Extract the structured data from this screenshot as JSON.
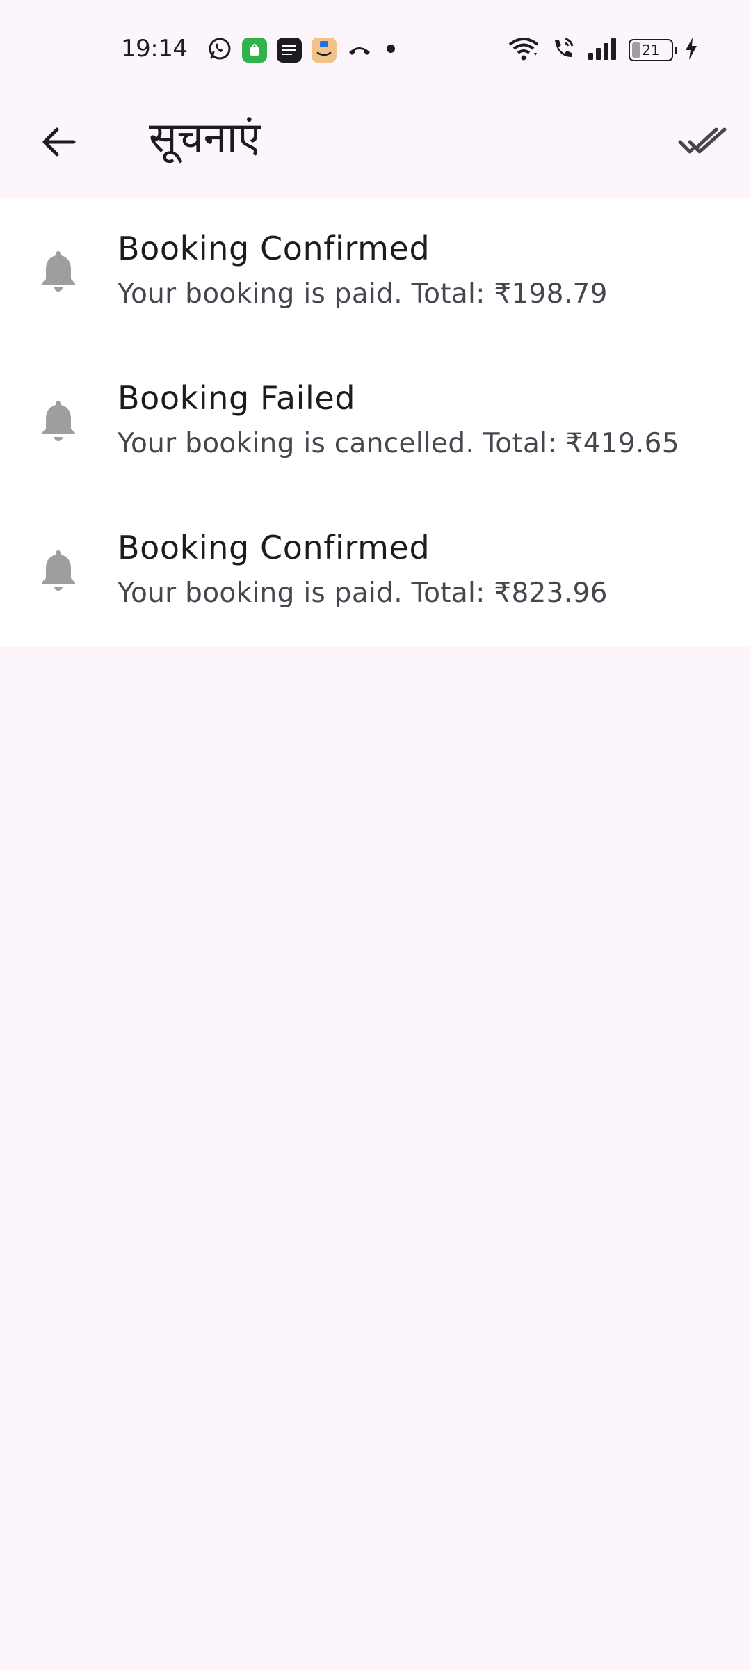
{
  "status_bar": {
    "time": "19:14",
    "battery_level": "21",
    "left_icons": [
      "whatsapp-icon",
      "app-store-icon",
      "news-app-icon",
      "amazon-icon",
      "missed-call-icon",
      "dot-icon"
    ],
    "right_icons": [
      "wifi-icon",
      "wifi-calling-icon",
      "signal-icon",
      "battery-icon",
      "charging-icon"
    ]
  },
  "app_bar": {
    "title": "सूचनाएं",
    "back_icon": "arrow-back-icon",
    "action_icon": "done-all-icon"
  },
  "notifications": [
    {
      "title": "Booking Confirmed",
      "body": "Your booking is paid. Total: ₹198.79",
      "icon": "bell-icon"
    },
    {
      "title": "Booking Failed",
      "body": "Your booking is cancelled. Total: ₹419.65",
      "icon": "bell-icon"
    },
    {
      "title": "Booking Confirmed",
      "body": "Your booking is paid. Total: ₹823.96",
      "icon": "bell-icon"
    }
  ],
  "colors": {
    "background": "#fcf5fc",
    "surface": "#ffffff",
    "icon_grey": "#9e9e9e",
    "text_primary": "#1c1b1f",
    "text_secondary": "#49454f"
  }
}
